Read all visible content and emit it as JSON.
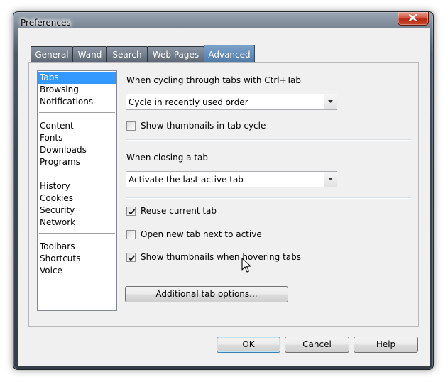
{
  "window": {
    "title": "Preferences"
  },
  "tabs": [
    {
      "label": "General",
      "active": false
    },
    {
      "label": "Wand",
      "active": false
    },
    {
      "label": "Search",
      "active": false
    },
    {
      "label": "Web Pages",
      "active": false
    },
    {
      "label": "Advanced",
      "active": true
    }
  ],
  "sidebar": {
    "items": [
      {
        "label": "Tabs",
        "selected": true
      },
      {
        "label": "Browsing"
      },
      {
        "label": "Notifications"
      },
      {
        "label": "Content"
      },
      {
        "label": "Fonts"
      },
      {
        "label": "Downloads"
      },
      {
        "label": "Programs"
      },
      {
        "label": "History"
      },
      {
        "label": "Cookies"
      },
      {
        "label": "Security"
      },
      {
        "label": "Network"
      },
      {
        "label": "Toolbars"
      },
      {
        "label": "Shortcuts"
      },
      {
        "label": "Voice"
      }
    ]
  },
  "settings": {
    "cycling_label": "When cycling through tabs with Ctrl+Tab",
    "cycling_select": "Cycle in recently used order",
    "show_thumbnails_cycle": {
      "label": "Show thumbnails in tab cycle",
      "checked": false
    },
    "closing_label": "When closing a tab",
    "closing_select": "Activate the last active tab",
    "reuse_current_tab": {
      "label": "Reuse current tab",
      "checked": true
    },
    "open_new_tab_next": {
      "label": "Open new tab next to active",
      "checked": false
    },
    "show_thumbnails_hover": {
      "label": "Show thumbnails when hovering tabs",
      "checked": true
    },
    "additional_options_button": "Additional tab options..."
  },
  "buttons": {
    "ok": "OK",
    "cancel": "Cancel",
    "help": "Help"
  },
  "colors": {
    "selection": "#3399ff",
    "active_tab": "#5b86b3",
    "close_button": "#c4442a"
  }
}
